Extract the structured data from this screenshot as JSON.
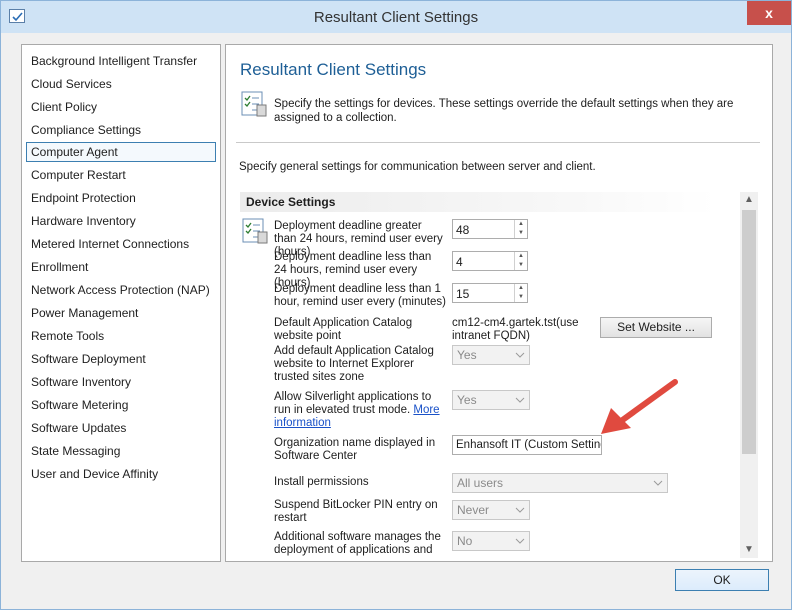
{
  "window": {
    "title": "Resultant Client Settings",
    "close_glyph": "x"
  },
  "sidebar": {
    "items": [
      {
        "label": "Background Intelligent Transfer",
        "selected": false
      },
      {
        "label": "Cloud Services",
        "selected": false
      },
      {
        "label": "Client Policy",
        "selected": false
      },
      {
        "label": "Compliance Settings",
        "selected": false
      },
      {
        "label": "Computer Agent",
        "selected": true
      },
      {
        "label": "Computer Restart",
        "selected": false
      },
      {
        "label": "Endpoint Protection",
        "selected": false
      },
      {
        "label": "Hardware Inventory",
        "selected": false
      },
      {
        "label": "Metered Internet Connections",
        "selected": false
      },
      {
        "label": "Enrollment",
        "selected": false
      },
      {
        "label": "Network Access Protection (NAP)",
        "selected": false
      },
      {
        "label": "Power Management",
        "selected": false
      },
      {
        "label": "Remote Tools",
        "selected": false
      },
      {
        "label": "Software Deployment",
        "selected": false
      },
      {
        "label": "Software Inventory",
        "selected": false
      },
      {
        "label": "Software Metering",
        "selected": false
      },
      {
        "label": "Software Updates",
        "selected": false
      },
      {
        "label": "State Messaging",
        "selected": false
      },
      {
        "label": "User and Device Affinity",
        "selected": false
      }
    ]
  },
  "main": {
    "title": "Resultant Client Settings",
    "description": "Specify the settings for devices. These settings override the default settings when they are assigned to a collection.",
    "general_description": "Specify general settings for communication between server and client.",
    "section_title": "Device Settings",
    "settings": {
      "deadline_gt24": {
        "label": "Deployment deadline greater than 24 hours, remind user every (hours)",
        "value": "48"
      },
      "deadline_lt24": {
        "label": "Deployment deadline less than 24 hours, remind user every (hours)",
        "value": "4"
      },
      "deadline_lt1": {
        "label": "Deployment deadline less than 1 hour, remind user every (minutes)",
        "value": "15"
      },
      "catalog_point": {
        "label": "Default Application Catalog website point",
        "value": "cm12-cm4.gartek.tst(use intranet FQDN)",
        "button": "Set Website ..."
      },
      "trusted_zone": {
        "label": "Add default Application Catalog website to Internet Explorer trusted sites zone",
        "value": "Yes"
      },
      "silverlight": {
        "label": "Allow Silverlight applications to run in elevated trust mode.",
        "link": "More information",
        "value": "Yes"
      },
      "org_name": {
        "label": "Organization name displayed in Software Center",
        "value": "Enhansoft IT (Custom Settings)"
      },
      "install_permissions": {
        "label": "Install permissions",
        "value": "All users"
      },
      "bitlocker": {
        "label": "Suspend BitLocker PIN entry on restart",
        "value": "Never"
      },
      "additional_software": {
        "label": "Additional software manages the deployment of applications and software updates",
        "value": "No"
      }
    }
  },
  "footer": {
    "ok_label": "OK"
  },
  "colors": {
    "accent": "#1e5f96",
    "title_bar": "#cfe3f5",
    "close": "#c7504b",
    "arrow": "#e04a3f",
    "link": "#1a52c8"
  }
}
